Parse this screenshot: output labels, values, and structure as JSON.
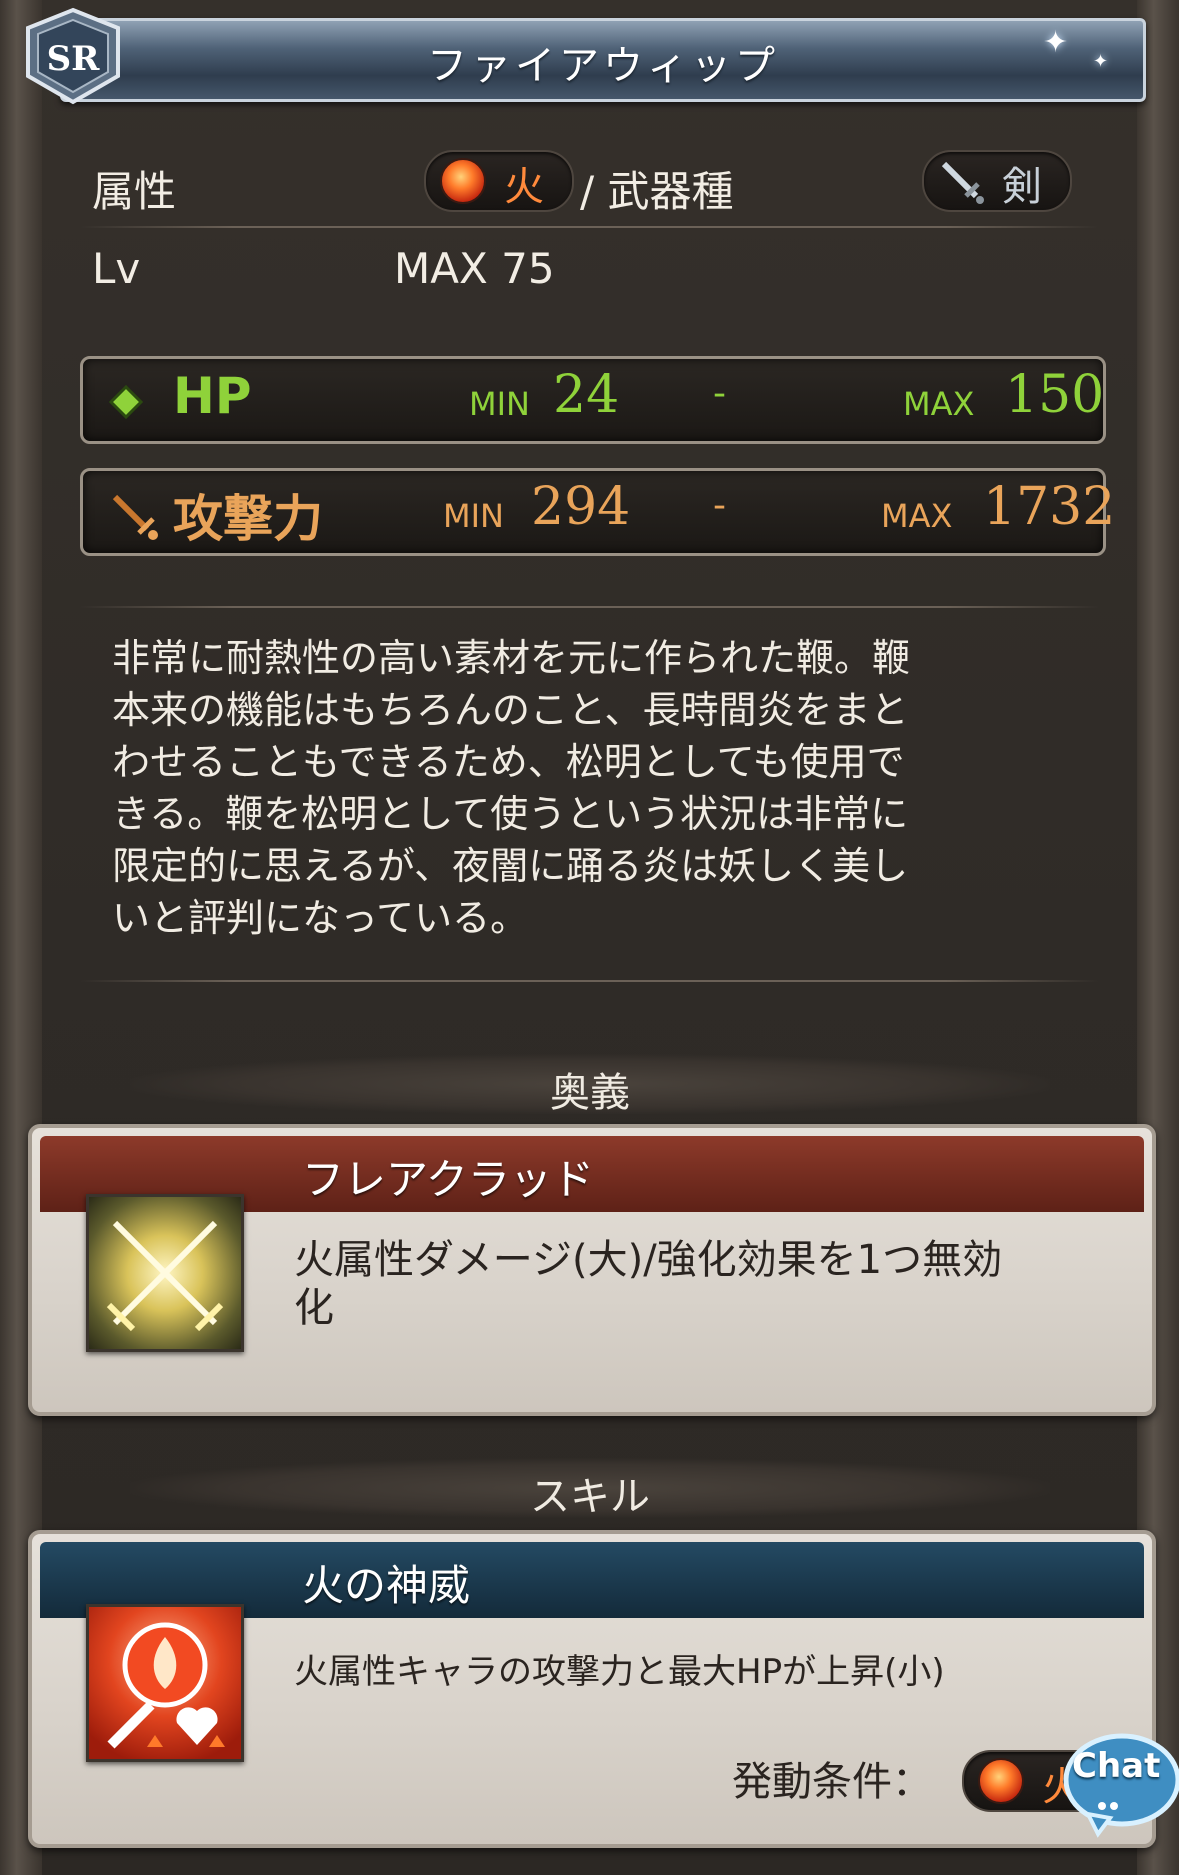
{
  "header": {
    "rarity": "SR",
    "title": "ファイアウィップ"
  },
  "info": {
    "attribute_label": "属性",
    "element": "火",
    "weapon_type_label": "/ 武器種",
    "weapon_type": "剣",
    "lv_label": "Lv",
    "lv_value": "MAX 75"
  },
  "stats": {
    "hp": {
      "label": "HP",
      "min_label": "MIN",
      "min": "24",
      "dash": "-",
      "max_label": "MAX",
      "max": "150"
    },
    "atk": {
      "label": "攻撃力",
      "min_label": "MIN",
      "min": "294",
      "dash": "-",
      "max_label": "MAX",
      "max": "1732"
    }
  },
  "description_lines": [
    "非常に耐熱性の高い素材を元に作られた鞭。鞭",
    "本来の機能はもちろんのこと、長時間炎をまと",
    "わせることもできるため、松明としても使用で",
    "きる。鞭を松明として使うという状況は非常に",
    "限定的に思えるが、夜闇に踊る炎は妖しく美し",
    "いと評判になっている。"
  ],
  "ougi": {
    "section_label": "奥義",
    "name": "フレアクラッド",
    "desc_line1": "火属性ダメージ(大)/強化効果を1つ無効",
    "desc_line2": "化",
    "icon": "crossed-swords-icon"
  },
  "skill": {
    "section_label": "スキル",
    "name": "火の神威",
    "desc": "火属性キャラの攻撃力と最大HPが上昇(小)",
    "condition_label": "発動条件：",
    "condition_element": "火",
    "icon": "fire-attack-hp-up-icon"
  },
  "chat": {
    "label": "Chat"
  },
  "colors": {
    "hp": "#8fd23a",
    "atk": "#e9a45a",
    "fire_text": "#ff8a3c",
    "ougi_header": "#7a2f22",
    "skill_header": "#1e3a4e"
  }
}
